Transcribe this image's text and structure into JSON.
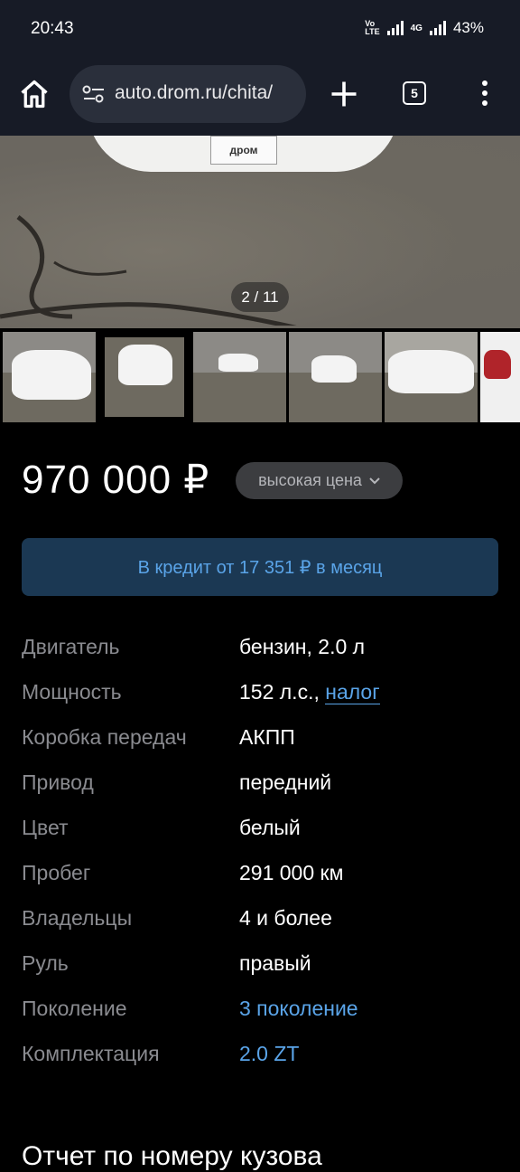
{
  "status_bar": {
    "time": "20:43",
    "volte": "Vo\nLTE",
    "net_type": "4G",
    "battery": "43%"
  },
  "browser": {
    "url": "auto.drom.ru/chita/",
    "tab_count": "5"
  },
  "gallery": {
    "plate_text": "дром",
    "counter": "2 / 11"
  },
  "price": {
    "value": "970 000 ₽",
    "badge": "высокая цена"
  },
  "credit_button": "В кредит от 17 351 ₽ в месяц",
  "specs": [
    {
      "label": "Двигатель",
      "value": "бензин, 2.0 л"
    },
    {
      "label": "Мощность",
      "value": "152 л.с.,",
      "link": "налог"
    },
    {
      "label": "Коробка передач",
      "value": "АКПП"
    },
    {
      "label": "Привод",
      "value": "передний"
    },
    {
      "label": "Цвет",
      "value": "белый"
    },
    {
      "label": "Пробег",
      "value": "291 000 км"
    },
    {
      "label": "Владельцы",
      "value": "4 и более"
    },
    {
      "label": "Руль",
      "value": "правый"
    },
    {
      "label": "Поколение",
      "value": "3 поколение"
    },
    {
      "label": "Комплектация",
      "value": "2.0 ZT"
    }
  ],
  "section_title": "Отчет по номеру кузова",
  "colors": {
    "accent": "#5aa4e8",
    "credit_bg": "#1b3853",
    "badge_bg": "#3c3d40",
    "toolbar_bg": "#171b26"
  }
}
